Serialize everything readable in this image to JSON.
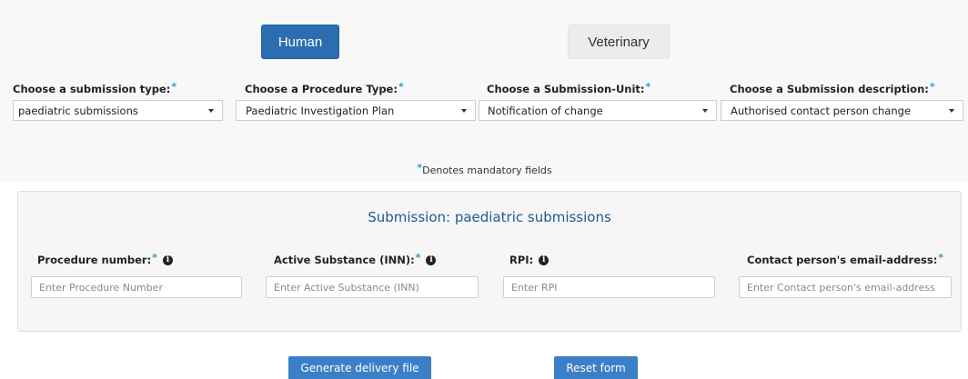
{
  "tabs": {
    "human": "Human",
    "veterinary": "Veterinary"
  },
  "required_mark": "*",
  "selectors": [
    {
      "label": "Choose a submission type:",
      "value": "paediatric submissions"
    },
    {
      "label": "Choose a Procedure Type:",
      "value": "Paediatric Investigation Plan"
    },
    {
      "label": "Choose a Submission-Unit:",
      "value": "Notification of change"
    },
    {
      "label": "Choose a Submission description:",
      "value": "Authorised contact person change"
    }
  ],
  "mandatory_note": "Denotes mandatory fields",
  "panel": {
    "title": "Submission: paediatric submissions",
    "fields": [
      {
        "label": "Procedure number:",
        "placeholder": "Enter Procedure Number"
      },
      {
        "label": "Active Substance (INN):",
        "placeholder": "Enter Active Substance (INN)"
      },
      {
        "label": "RPI:",
        "placeholder": "Enter RPI"
      },
      {
        "label": "Contact person's email-address:",
        "placeholder": "Enter Contact person's email-address"
      }
    ]
  },
  "actions": {
    "generate": "Generate delivery file",
    "reset": "Reset form"
  },
  "colors": {
    "primary": "#2a6eb0",
    "button": "#3b80c6",
    "required": "#2e9ad6",
    "title": "#1f5a93"
  }
}
